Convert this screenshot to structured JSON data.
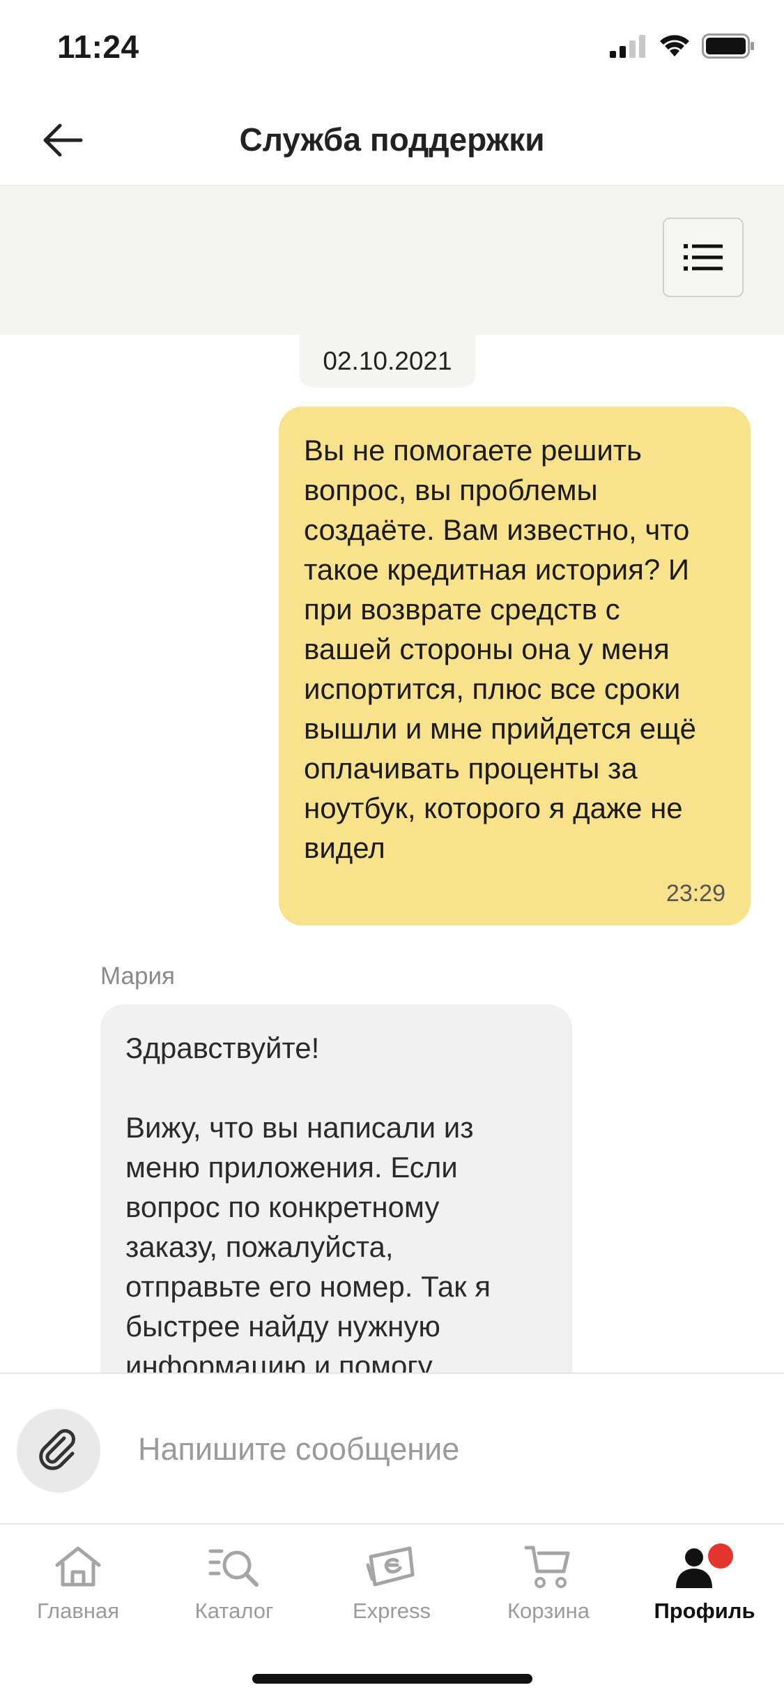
{
  "status_bar": {
    "time": "11:24"
  },
  "header": {
    "title": "Служба поддержки"
  },
  "chat": {
    "date": "02.10.2021",
    "outgoing": {
      "text": "Вы не помогаете решить\nвопрос, вы проблемы\nсоздаёте. Вам известно, что\nтакое кредитная история? И\nпри возврате средств с\nвашей стороны она у меня\nиспортится, плюс все сроки\nвышли и мне прийдется ещё\nоплачивать проценты за\nноутбук, которого я даже не\nвидел",
      "time": "23:29"
    },
    "incoming": {
      "sender": "Мария",
      "text": "Здравствуйте!\n\nВижу, что вы написали из\nменю приложения. Если\nвопрос по конкретному\nзаказу, пожалуйста,\nотправьте его номер. Так я\nбыстрее найду нужную\nинформацию и помогу"
    }
  },
  "composer": {
    "placeholder": "Напишите сообщение"
  },
  "tabbar": {
    "items": [
      {
        "label": "Главная",
        "icon": "home-icon"
      },
      {
        "label": "Каталог",
        "icon": "catalog-search-icon"
      },
      {
        "label": "Express",
        "icon": "express-icon"
      },
      {
        "label": "Корзина",
        "icon": "cart-icon"
      },
      {
        "label": "Профиль",
        "icon": "profile-icon",
        "active": true
      }
    ]
  },
  "colors": {
    "outgoing_bubble": "#f8e38c",
    "incoming_bubble": "#f1f1f1",
    "banner": "#f3f3f1",
    "notification_dot": "#e3342f"
  }
}
